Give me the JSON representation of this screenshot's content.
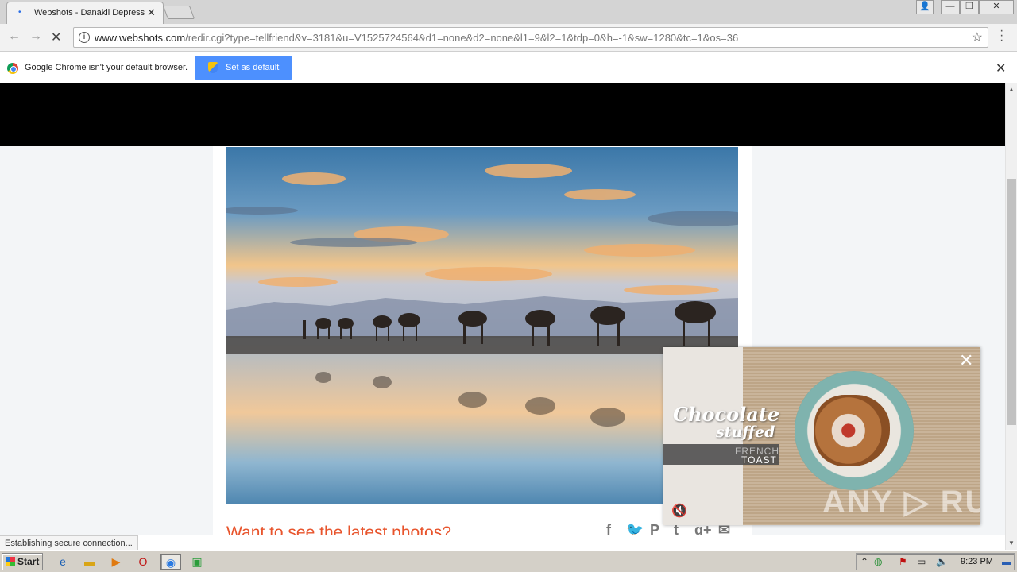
{
  "browser": {
    "tab": {
      "title": "Webshots - Danakil Depress",
      "close": "✕"
    },
    "window_buttons": {
      "user": "👤",
      "minimize": "—",
      "restore": "❐",
      "close": "✕"
    },
    "nav": {
      "back": "←",
      "forward": "→",
      "reload": "✕"
    },
    "url": {
      "host": "www.webshots.com",
      "path": "/redir.cgi?type=tellfriend&v=3181&u=V1525724564&d1=none&d2=none&l1=9&l2=1&tdp=0&h=-1&sw=1280&tc=1&os=36"
    },
    "star": "☆",
    "menu": "⋮"
  },
  "infobar": {
    "message": "Google Chrome isn't your default browser.",
    "button": "Set as default",
    "close": "✕"
  },
  "page": {
    "cta": "Want to see the latest photos?",
    "share_icons": [
      "facebook-icon",
      "twitter-icon",
      "pinterest-icon",
      "tumblr-icon",
      "googleplus-icon",
      "mail-icon"
    ],
    "share_glyphs": {
      "facebook": "f",
      "twitter": "🐦",
      "pinterest": "P",
      "tumblr": "t",
      "googleplus": "g+",
      "mail": "✉"
    }
  },
  "ad": {
    "title_line1": "Chocolate",
    "title_line2": "stuffed",
    "subtitle_line1": "FRENCH",
    "subtitle_line2": "TOAST",
    "close": "✕",
    "mute": "🔇",
    "watermark": "ANY ▷ RUN"
  },
  "status": {
    "text": "Establishing secure connection..."
  },
  "taskbar": {
    "start": "Start",
    "clock": "9:23 PM"
  }
}
